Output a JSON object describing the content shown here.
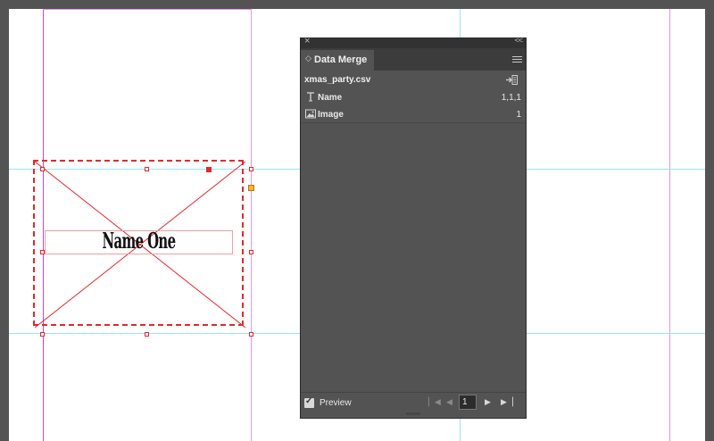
{
  "panel": {
    "title": "Data Merge",
    "source_name": "xmas_party.csv",
    "fields": [
      {
        "icon": "text-field-icon",
        "name": "Name",
        "value": "1,1,1"
      },
      {
        "icon": "image-field-icon",
        "name": "Image",
        "value": "1"
      }
    ],
    "preview_label": "Preview",
    "preview_checked": true,
    "record_number": "1"
  },
  "document": {
    "placeholder_text": "Name One"
  },
  "colors": {
    "frame_red": "#e8262b",
    "guide_cyan": "#9ae6ec",
    "margin_magenta": "#c34bc8",
    "panel_bg": "#535353",
    "pasteboard": "#535353"
  }
}
